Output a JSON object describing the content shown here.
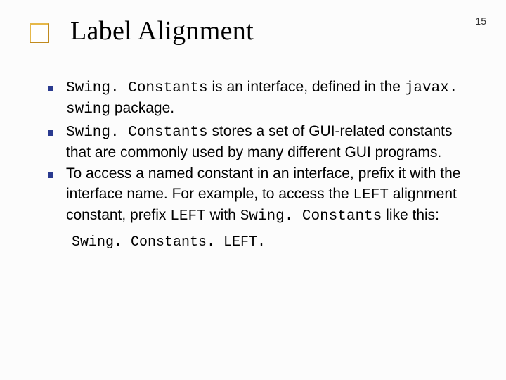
{
  "page_number": "15",
  "title": "Label Alignment",
  "bullets": [
    {
      "seg": [
        {
          "t": "Swing. Constants",
          "mono": true
        },
        {
          "t": " is an interface, defined in the ",
          "mono": false
        },
        {
          "t": "javax. swing",
          "mono": true
        },
        {
          "t": " package.",
          "mono": false
        }
      ]
    },
    {
      "seg": [
        {
          "t": "Swing. Constants",
          "mono": true
        },
        {
          "t": " stores a set of GUI-related constants that are commonly used by many different GUI programs.",
          "mono": false
        }
      ]
    },
    {
      "seg": [
        {
          "t": "To access a named constant in an interface, prefix it with the interface name. For example, to access the ",
          "mono": false
        },
        {
          "t": "LEFT",
          "mono": true
        },
        {
          "t": " alignment constant, prefix ",
          "mono": false
        },
        {
          "t": "LEFT",
          "mono": true
        },
        {
          "t": " with ",
          "mono": false
        },
        {
          "t": "Swing. Constants",
          "mono": true
        },
        {
          "t": " like this:",
          "mono": false
        }
      ]
    }
  ],
  "trailer": "Swing. Constants. LEFT."
}
